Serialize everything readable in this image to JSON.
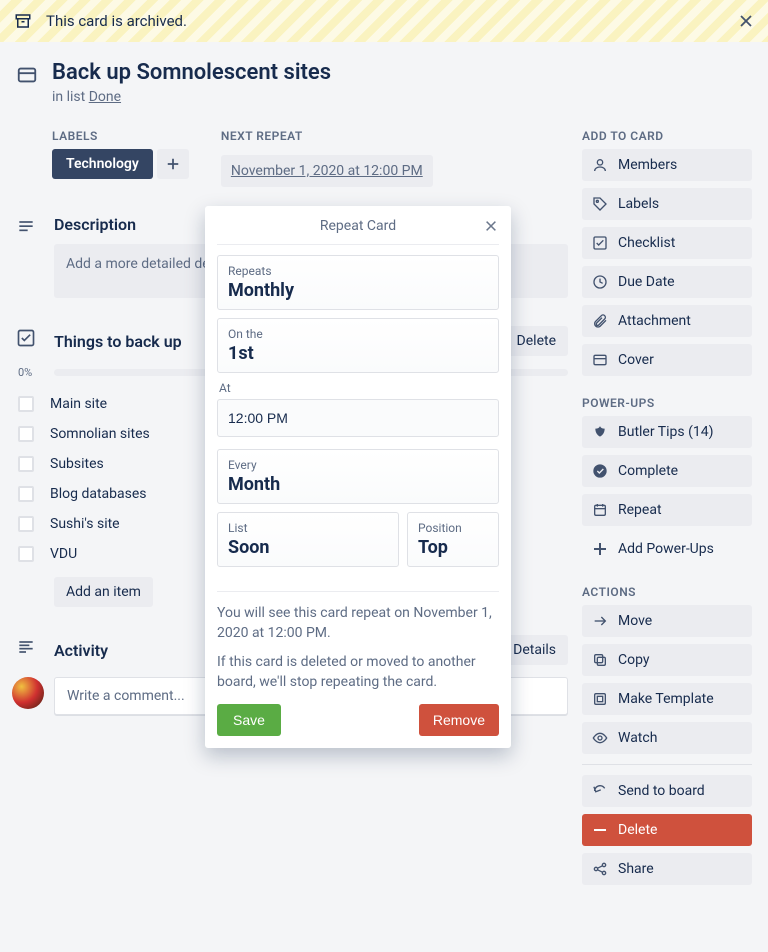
{
  "archived": {
    "message": "This card is archived."
  },
  "card": {
    "title": "Back up Somnolescent sites",
    "in_list_prefix": "in list ",
    "list_name": "Done"
  },
  "labels": {
    "heading": "LABELS",
    "items": [
      "Technology"
    ]
  },
  "next_repeat": {
    "heading": "NEXT REPEAT",
    "value": "November 1, 2020 at 12:00 PM"
  },
  "description": {
    "heading": "Description",
    "placeholder": "Add a more detailed description..."
  },
  "checklist": {
    "heading": "Things to back up",
    "delete_label": "Delete",
    "progress_pct": "0%",
    "items": [
      "Main site",
      "Somnolian sites",
      "Subsites",
      "Blog databases",
      "Sushi's site",
      "VDU"
    ],
    "add_item_label": "Add an item"
  },
  "activity": {
    "heading": "Activity",
    "details_label": "Details",
    "comment_placeholder": "Write a comment..."
  },
  "sidebar": {
    "add_to_card": {
      "heading": "ADD TO CARD",
      "members": "Members",
      "labels": "Labels",
      "checklist": "Checklist",
      "due_date": "Due Date",
      "attachment": "Attachment",
      "cover": "Cover"
    },
    "power_ups": {
      "heading": "POWER-UPS",
      "butler_tips": "Butler Tips (14)",
      "complete": "Complete",
      "repeat": "Repeat",
      "add_power_ups": "Add Power-Ups"
    },
    "actions": {
      "heading": "ACTIONS",
      "move": "Move",
      "copy": "Copy",
      "make_template": "Make Template",
      "watch": "Watch",
      "send_to_board": "Send to board",
      "delete": "Delete",
      "share": "Share"
    }
  },
  "popover": {
    "title": "Repeat Card",
    "repeats_label": "Repeats",
    "repeats_value": "Monthly",
    "on_the_label": "On the",
    "on_the_value": "1st",
    "at_label": "At",
    "at_value": "12:00 PM",
    "every_label": "Every",
    "every_value": "Month",
    "list_label": "List",
    "list_value": "Soon",
    "position_label": "Position",
    "position_value": "Top",
    "info1": "You will see this card repeat on November 1, 2020 at 12:00 PM.",
    "info2": "If this card is deleted or moved to another board, we'll stop repeating the card.",
    "save": "Save",
    "remove": "Remove"
  }
}
